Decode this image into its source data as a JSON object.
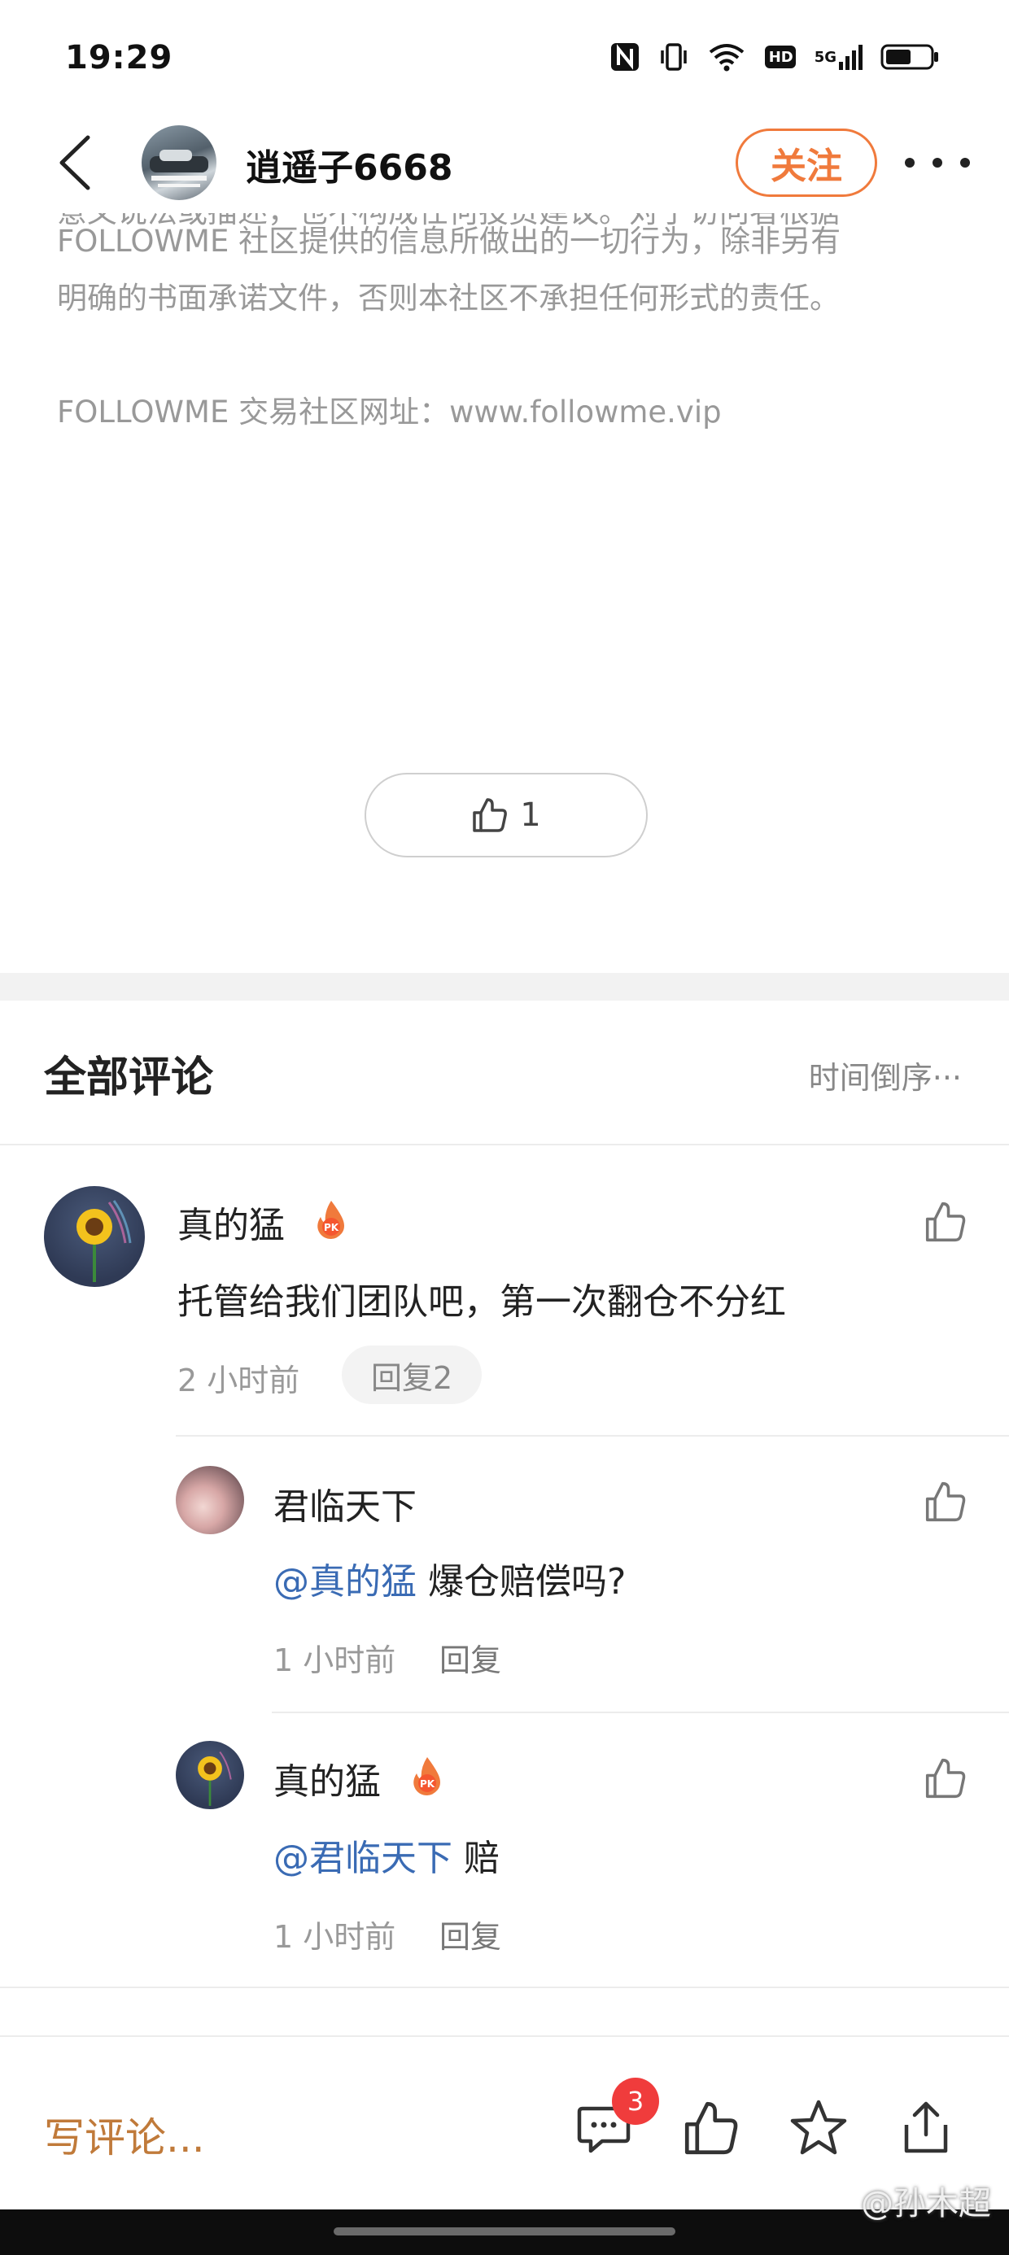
{
  "status_bar": {
    "time": "19:29",
    "icons": [
      "nfc-icon",
      "vibrate-icon",
      "wifi-icon",
      "hd-icon",
      "signal-5g-icon",
      "battery-icon"
    ],
    "hd_label": "HD",
    "signal_label": "5G"
  },
  "header": {
    "author_name": "逍遥子6668",
    "follow_label": "关注"
  },
  "article": {
    "lines": [
      "意义说法或描述，也不构成任何投资建议。对于访问者根据",
      "FOLLOWME 社区提供的信息所做出的一切行为，除非另有",
      "明确的书面承诺文件，否则本社区不承担任何形式的责任。",
      "FOLLOWME 交易社区网址：www.followme.vip"
    ]
  },
  "like": {
    "count": "1"
  },
  "comments_section": {
    "title": "全部评论",
    "sort_label": "时间倒序",
    "sort_more": "···"
  },
  "comments": [
    {
      "name": "真的猛",
      "badge": "PK",
      "text": "托管给我们团队吧，第一次翻仓不分红",
      "time": "2 小时前",
      "reply_label": "回复2",
      "replies": [
        {
          "name": "君临天下",
          "mention": "@真的猛",
          "text": " 爆仓赔偿吗?",
          "time": "1 小时前",
          "reply_label": "回复"
        },
        {
          "name": "真的猛",
          "badge": "PK",
          "mention": "@君临天下",
          "text": " 赔",
          "time": "1 小时前",
          "reply_label": "回复"
        }
      ]
    }
  ],
  "bottom_bar": {
    "write_comment": "写评论...",
    "comment_count": "3"
  },
  "watermark": "@孙木超",
  "colors": {
    "accent_orange": "#f07a3c",
    "mention_blue": "#3a6bb4",
    "badge_red": "#f03c3c",
    "write_comment_color": "#c07a3a"
  }
}
